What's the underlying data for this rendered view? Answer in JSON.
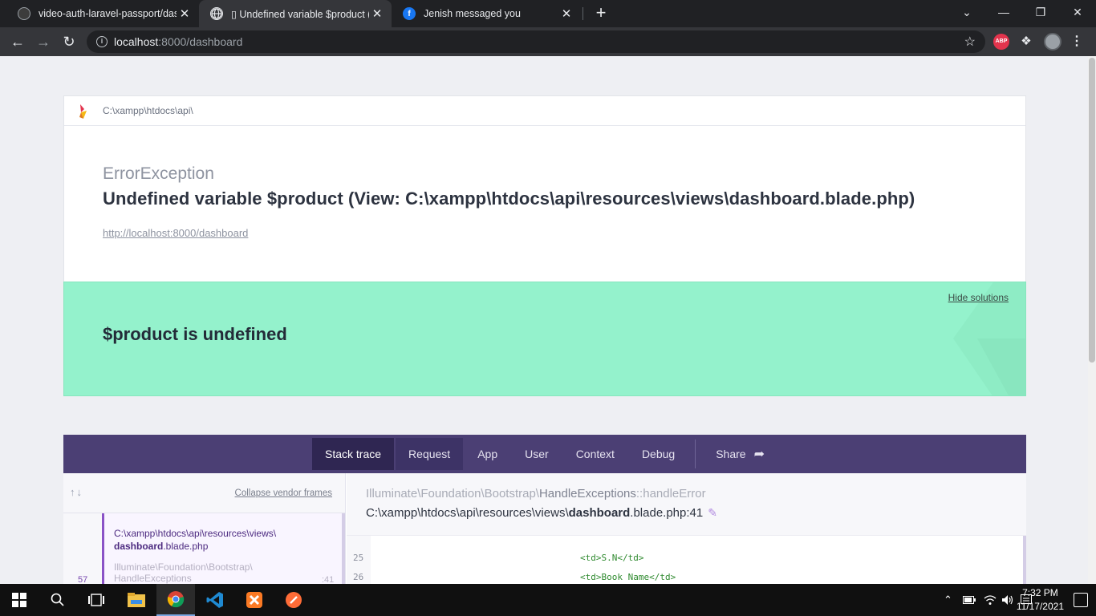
{
  "browser": {
    "tabs": [
      {
        "title": "video-auth-laravel-passport/dash",
        "icon": "github-icon"
      },
      {
        "title": "▯ Undefined variable $product (V",
        "icon": "globe-icon"
      },
      {
        "title": "Jenish messaged you",
        "icon": "facebook-icon"
      }
    ],
    "new_tab_glyph": "+",
    "close_glyph": "✕",
    "url_host": "localhost",
    "url_rest": ":8000/dashboard",
    "ext_abp": "ABP"
  },
  "page": {
    "app_path": "C:\\xampp\\htdocs\\api\\",
    "exception_class": "ErrorException",
    "exception_message": "Undefined variable $product (View: C:\\xampp\\htdocs\\api\\resources\\views\\dashboard.blade.php)",
    "request_url": "http://localhost:8000/dashboard",
    "solution": {
      "hide_label": "Hide solutions",
      "title": "$product is undefined"
    },
    "tabs": [
      "Stack trace",
      "Request",
      "App",
      "User",
      "Context",
      "Debug",
      "Share"
    ],
    "stack": {
      "collapse_label": "Collapse vendor frames",
      "selected_frame": {
        "path_prefix": "C:\\xampp\\htdocs\\api\\resources\\views\\",
        "file_bold": "dashboard",
        "file_rest": ".blade.php"
      },
      "next_frame": {
        "ns": "Illuminate\\Foundation\\Bootstrap\\",
        "cls": "HandleExceptions",
        "number": "57",
        "line": ":41"
      },
      "detail": {
        "ns": "Illuminate\\Foundation\\Bootstrap\\",
        "cls": "HandleExceptions",
        "method": "::handleError",
        "file_prefix": "C:\\xampp\\htdocs\\api\\resources\\views\\",
        "file_bold": "dashboard",
        "file_rest": ".blade.php:41"
      },
      "code_lines": [
        {
          "n": "25",
          "src": "<td>S.N</td>"
        },
        {
          "n": "26",
          "src": "<td>Book Name</td>"
        }
      ]
    }
  },
  "taskbar": {
    "time": "7:32 PM",
    "date": "11/17/2021"
  }
}
